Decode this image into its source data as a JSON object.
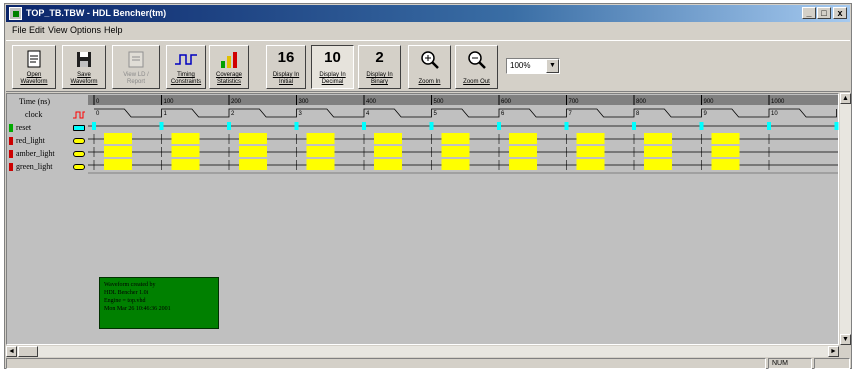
{
  "window": {
    "title": "TOP_TB.TBW - HDL Bencher(tm)",
    "minimize_glyph": "_",
    "restore_glyph": "□",
    "close_glyph": "x"
  },
  "menubar": {
    "items": [
      "File",
      "Edit",
      "View",
      "Options",
      "Help"
    ]
  },
  "toolbar": {
    "open_waveform": "Open Waveform",
    "save_waveform": "Save Waveform",
    "view_ld": "View LD / Report",
    "timing_constraints": "Timing Constraints",
    "coverage_statistics": "Coverage Statistics",
    "display_initial_num": "16",
    "display_initial_label": "Display In Initial",
    "display_decimal_num": "10",
    "display_decimal_label": "Display In Decimal",
    "display_binary_num": "2",
    "display_binary_label": "Display In Binary",
    "zoom_in": "Zoom In",
    "zoom_out": "Zoom Out",
    "zoom_value": "100%",
    "zoom_arrow": "▼"
  },
  "waveform": {
    "time_label": "Time (ns)",
    "time_ticks": [
      "0",
      "100",
      "200",
      "300",
      "400",
      "500",
      "600",
      "700",
      "800",
      "900",
      "1000"
    ],
    "clock_values": [
      "0",
      "1",
      "2",
      "3",
      "4",
      "5",
      "6",
      "7",
      "8",
      "9",
      "10",
      "11"
    ],
    "signals": [
      {
        "name": "clock",
        "color": "#ff0000"
      },
      {
        "name": "reset",
        "color": "#00aa00"
      },
      {
        "name": "red_light",
        "color": "#cc0000"
      },
      {
        "name": "amber_light",
        "color": "#cc0000"
      },
      {
        "name": "green_light",
        "color": "#cc0000"
      }
    ],
    "highlight_color": "#ffff00",
    "edge_marker_color": "#00ffff"
  },
  "tooltip": {
    "lines": [
      "Waveform created by",
      "HDL Bencher 1.0i",
      "Engine = top.vhd",
      "Mon Mar 26 10:46:36 2001"
    ]
  },
  "statusbar": {
    "num": "NUM"
  },
  "scroll": {
    "up": "▲",
    "down": "▼",
    "left": "◄",
    "right": "►"
  }
}
